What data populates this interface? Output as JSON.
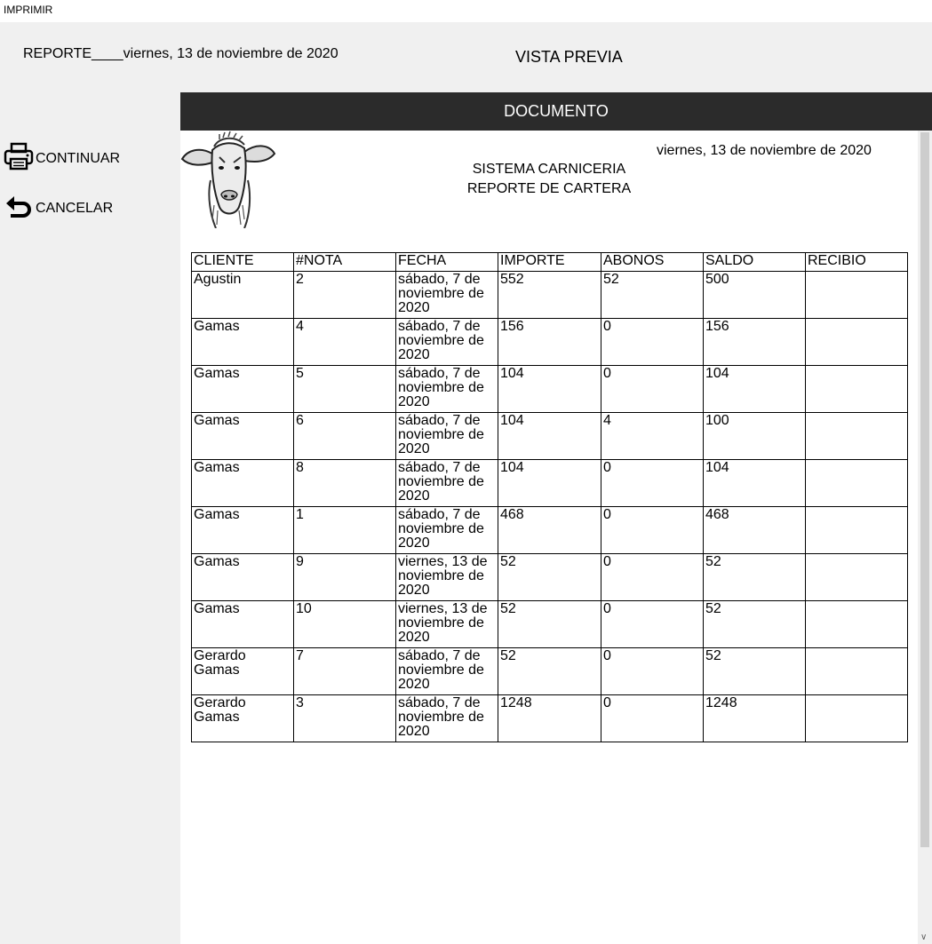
{
  "window": {
    "title": "IMPRIMIR"
  },
  "header": {
    "report_label": "REPORTE____viernes, 13 de noviembre de 2020",
    "preview_title": "VISTA PREVIA"
  },
  "actions": {
    "continue_label": "CONTINUAR",
    "cancel_label": "CANCELAR"
  },
  "document": {
    "header": "DOCUMENTO",
    "date": "viernes, 13 de noviembre de 2020",
    "system_title": "SISTEMA CARNICERIA",
    "report_title": "REPORTE DE CARTERA",
    "columns": [
      "CLIENTE",
      "#NOTA",
      "FECHA",
      "IMPORTE",
      "ABONOS",
      "SALDO",
      "RECIBIO"
    ],
    "rows": [
      [
        "Agustin",
        "2",
        "sábado, 7 de noviembre de 2020",
        "552",
        "52",
        "500",
        ""
      ],
      [
        "Gamas",
        "4",
        "sábado, 7 de noviembre de 2020",
        "156",
        "0",
        "156",
        ""
      ],
      [
        "Gamas",
        "5",
        "sábado, 7 de noviembre de 2020",
        "104",
        "0",
        "104",
        ""
      ],
      [
        "Gamas",
        "6",
        "sábado, 7 de noviembre de 2020",
        "104",
        "4",
        "100",
        ""
      ],
      [
        "Gamas",
        "8",
        "sábado, 7 de noviembre de 2020",
        "104",
        "0",
        "104",
        ""
      ],
      [
        "Gamas",
        "1",
        "sábado, 7 de noviembre de 2020",
        "468",
        "0",
        "468",
        ""
      ],
      [
        "Gamas",
        "9",
        "viernes, 13 de noviembre de 2020",
        "52",
        "0",
        "52",
        ""
      ],
      [
        "Gamas",
        "10",
        "viernes, 13 de noviembre de 2020",
        "52",
        "0",
        "52",
        ""
      ],
      [
        "Gerardo Gamas",
        "7",
        "sábado, 7 de noviembre de 2020",
        "52",
        "0",
        "52",
        ""
      ],
      [
        "Gerardo Gamas",
        "3",
        "sábado, 7 de noviembre de 2020",
        "1248",
        "0",
        "1248",
        ""
      ]
    ]
  },
  "icons": {
    "continue": "printer-icon",
    "cancel": "undo-arrow-icon",
    "logo": "cow-head-icon",
    "scroll_down": "chevron-down-icon"
  },
  "colors": {
    "window_bg": "#f0f0f0",
    "document_header_bg": "#2b2b2b",
    "document_header_text": "#ffffff",
    "page_bg": "#ffffff"
  }
}
